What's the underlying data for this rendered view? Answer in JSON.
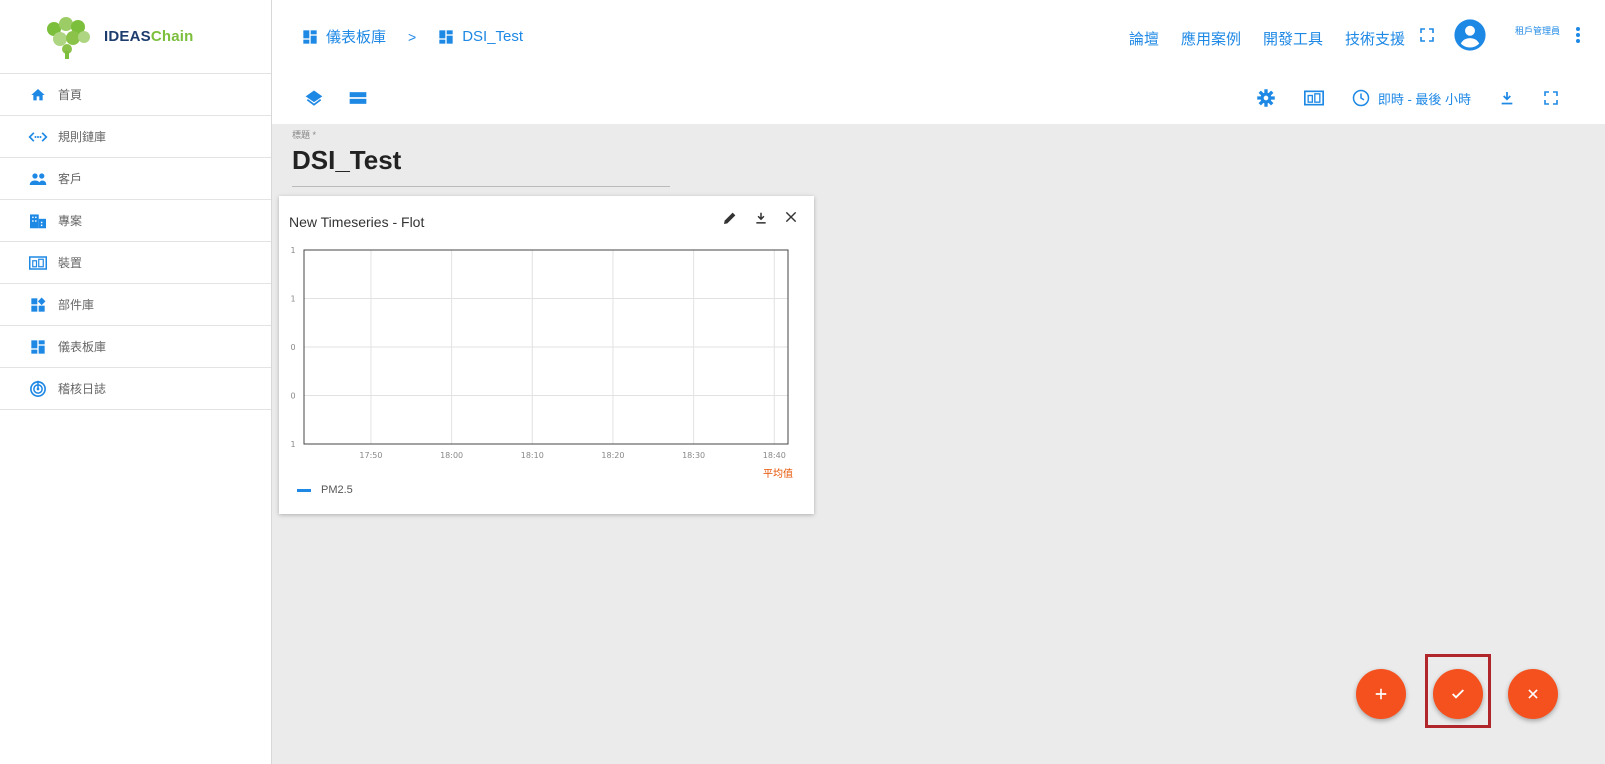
{
  "app": {
    "logo_text_main": "IDEAS",
    "logo_text_accent": "Chain"
  },
  "sidebar": {
    "items": [
      {
        "label": "首頁",
        "icon": "home-icon"
      },
      {
        "label": "規則鏈庫",
        "icon": "code-icon"
      },
      {
        "label": "客戶",
        "icon": "people-icon"
      },
      {
        "label": "專案",
        "icon": "building-icon"
      },
      {
        "label": "裝置",
        "icon": "devices-icon"
      },
      {
        "label": "部件庫",
        "icon": "widgets-icon"
      },
      {
        "label": "儀表板庫",
        "icon": "dashboard-icon"
      },
      {
        "label": "稽核日誌",
        "icon": "track-changes-icon"
      }
    ]
  },
  "header": {
    "breadcrumb": [
      {
        "label": "儀表板庫",
        "icon": "dashboard-icon"
      },
      {
        "label": "DSI_Test",
        "icon": "dashboard-icon"
      }
    ],
    "breadcrumb_separator": ">",
    "links": [
      "論壇",
      "應用案例",
      "開發工具",
      "技術支援"
    ],
    "user_name": "租戶管理員"
  },
  "toolbar": {
    "time_window": "即時 - 最後 小時"
  },
  "dashboard": {
    "title_label": "標題 *",
    "title_value": "DSI_Test"
  },
  "widget": {
    "title": "New Timeseries - Flot",
    "aggregation_label": "平均值",
    "legend": [
      "PM2.5"
    ]
  },
  "colors": {
    "accent": "#1e88e5",
    "fab": "#f4511e",
    "highlight": "#b0262b",
    "aggregation": "#e65100"
  },
  "chart_data": {
    "type": "line",
    "title": "New Timeseries - Flot",
    "x_ticks": [
      "17:50",
      "18:00",
      "18:10",
      "18:20",
      "18:30",
      "18:40"
    ],
    "y_ticks": [
      "1",
      "1",
      "0",
      "0",
      "1"
    ],
    "series": [
      {
        "name": "PM2.5",
        "values": []
      }
    ],
    "grid": true,
    "legend": "bottom-left"
  }
}
